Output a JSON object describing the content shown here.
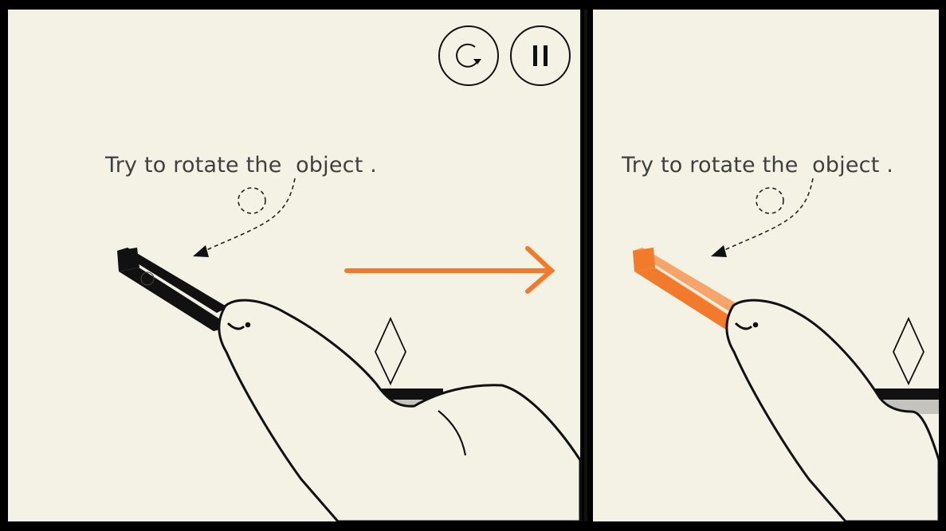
{
  "hint_text": "Try to rotate the  object .",
  "controls": {
    "restart_icon": "restart-icon",
    "pause_icon": "pause-icon"
  },
  "colors": {
    "paper": "#f3f2e4",
    "ink": "#111111",
    "accent": "#f27b2b"
  }
}
